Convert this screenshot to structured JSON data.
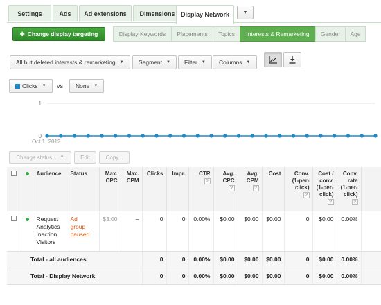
{
  "top_tabs": [
    "Settings",
    "Ads",
    "Ad extensions",
    "Dimensions",
    "Display Network"
  ],
  "active_tab": "Display Network",
  "change_targeting_label": "Change display targeting",
  "sub_tabs": [
    "Display Keywords",
    "Placements",
    "Topics",
    "Interests & Remarketing",
    "Gender",
    "Age"
  ],
  "active_sub_tab": "Interests & Remarketing",
  "toolbar": {
    "view_filter": "All but deleted interests & remarketing",
    "segment": "Segment",
    "filter": "Filter",
    "columns": "Columns"
  },
  "metric_selector": {
    "primary": "Clicks",
    "primary_color": "#1e88c8",
    "vs": "vs",
    "secondary": "None"
  },
  "chart_data": {
    "type": "line",
    "series": [
      {
        "name": "Clicks",
        "values": [
          0,
          0,
          0,
          0,
          0,
          0,
          0,
          0,
          0,
          0,
          0,
          0,
          0,
          0,
          0,
          0,
          0,
          0,
          0,
          0,
          0,
          0,
          0,
          0,
          0
        ]
      }
    ],
    "x_start_label": "Oct 1, 2012",
    "y_ticks": [
      "1",
      "0"
    ],
    "ylim": [
      0,
      1
    ],
    "color": "#1e88c8"
  },
  "actions": {
    "change_status": "Change status...",
    "edit": "Edit",
    "copy": "Copy..."
  },
  "table": {
    "headers": {
      "audience": "Audience",
      "status": "Status",
      "max_cpc": [
        "Max.",
        "CPC"
      ],
      "max_cpm": [
        "Max.",
        "CPM"
      ],
      "clicks": "Clicks",
      "impr": "Impr.",
      "ctr": "CTR",
      "avg_cpc": [
        "Avg.",
        "CPC"
      ],
      "avg_cpm": [
        "Avg.",
        "CPM"
      ],
      "cost": "Cost",
      "conv": [
        "Conv.",
        "(1-per-",
        "click)"
      ],
      "cost_conv": [
        "Cost /",
        "conv.",
        "(1-per-",
        "click)"
      ],
      "conv_rate": [
        "Conv.",
        "rate",
        "(1-per-",
        "click)"
      ],
      "help": "?"
    },
    "row": {
      "audience": [
        "Request",
        "Analytics",
        "Inaction",
        "Visitors"
      ],
      "status": [
        "Ad",
        "group",
        "paused"
      ],
      "max_cpc": "$3.00",
      "max_cpm": "–",
      "clicks": "0",
      "impr": "0",
      "ctr": "0.00%",
      "avg_cpc": "$0.00",
      "avg_cpm": "$0.00",
      "cost": "$0.00",
      "conv": "0",
      "cost_conv": "$0.00",
      "conv_rate": "0.00%"
    },
    "totals": [
      {
        "label": "Total - all audiences",
        "clicks": "0",
        "impr": "0",
        "ctr": "0.00%",
        "avg_cpc": "$0.00",
        "avg_cpm": "$0.00",
        "cost": "$0.00",
        "conv": "0",
        "cost_conv": "$0.00",
        "conv_rate": "0.00%"
      },
      {
        "label": "Total - Display Network",
        "clicks": "0",
        "impr": "0",
        "ctr": "0.00%",
        "avg_cpc": "$0.00",
        "avg_cpm": "$0.00",
        "cost": "$0.00",
        "conv": "0",
        "cost_conv": "$0.00",
        "conv_rate": "0.00%"
      }
    ]
  }
}
